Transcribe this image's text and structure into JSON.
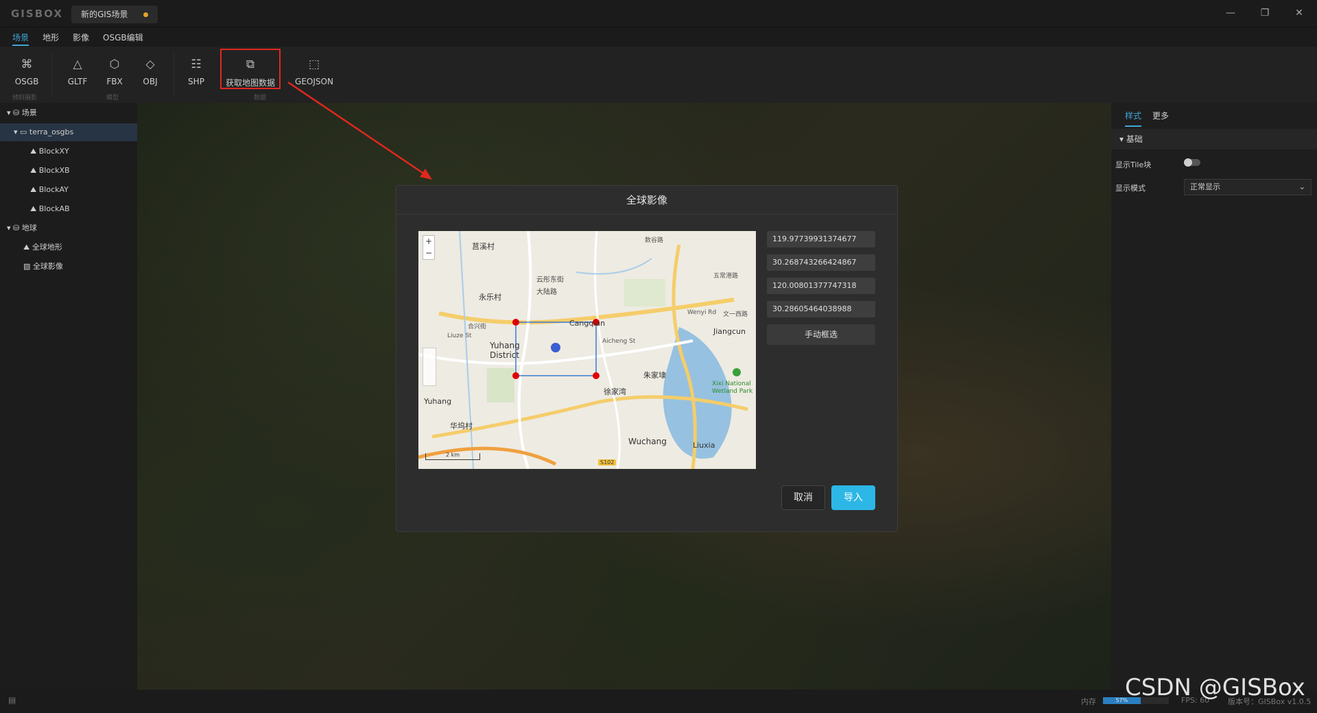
{
  "app": {
    "logo": "GISBOX",
    "doc_tab": "新的GIS场景"
  },
  "window": {
    "minimize_icon": "minimize-icon",
    "restore_icon": "restore-icon",
    "close_icon": "close-icon"
  },
  "menu": [
    "场景",
    "地形",
    "影像",
    "OSGB编辑"
  ],
  "ribbon": {
    "osgb": "OSGB",
    "group_osgb": "倾斜摄影",
    "gltf": "GLTF",
    "fbx": "FBX",
    "obj": "OBJ",
    "group_model": "模型",
    "shp": "SHP",
    "getmap": "获取地图数据",
    "geojson": "GEOJSON",
    "group_data": "数据"
  },
  "tree": {
    "scene": "场景",
    "terra": "terra_osgbs",
    "blocks": [
      "BlockXY",
      "BlockXB",
      "BlockAY",
      "BlockAB"
    ],
    "earth": "地球",
    "terrain": "全球地形",
    "imagery": "全球影像"
  },
  "right_panel": {
    "tabs": [
      "样式",
      "更多"
    ],
    "section": "基础",
    "show_tile_label": "显示Tile块",
    "display_mode_label": "显示模式",
    "display_mode_value": "正常显示"
  },
  "modal": {
    "title": "全球影像",
    "coords": [
      "119.97739931374677",
      "30.268743266424867",
      "120.00801377747318",
      "30.28605464038988"
    ],
    "manual_select": "手动框选",
    "cancel": "取消",
    "import": "导入"
  },
  "map": {
    "zoom_in": "+",
    "zoom_out": "−",
    "scale": "2 km",
    "road_shield": "S102",
    "labels": [
      "莒溪村",
      "永乐村",
      "云彤东街",
      "大陆路",
      "合兴街",
      "Liuze St",
      "Yuhang District",
      "Cangqian",
      "Aicheng St",
      "Wenyi Rd",
      "文一西路",
      "Jiangcun",
      "朱家埭",
      "徐家湾",
      "Yuhang",
      "华坞村",
      "Wuchang",
      "Liuxia",
      "Xixi National Wetland Park",
      "数谷路",
      "五常港路"
    ]
  },
  "status": {
    "memory_label": "内存",
    "memory_value": "57%",
    "fps": "FPS: 60",
    "version": "版本号：GISBox v1.0.5"
  },
  "watermark": "CSDN @GISBox",
  "colors": {
    "accent": "#2db7e6",
    "highlight": "#e0281e",
    "selection_marker": "#e00000"
  }
}
